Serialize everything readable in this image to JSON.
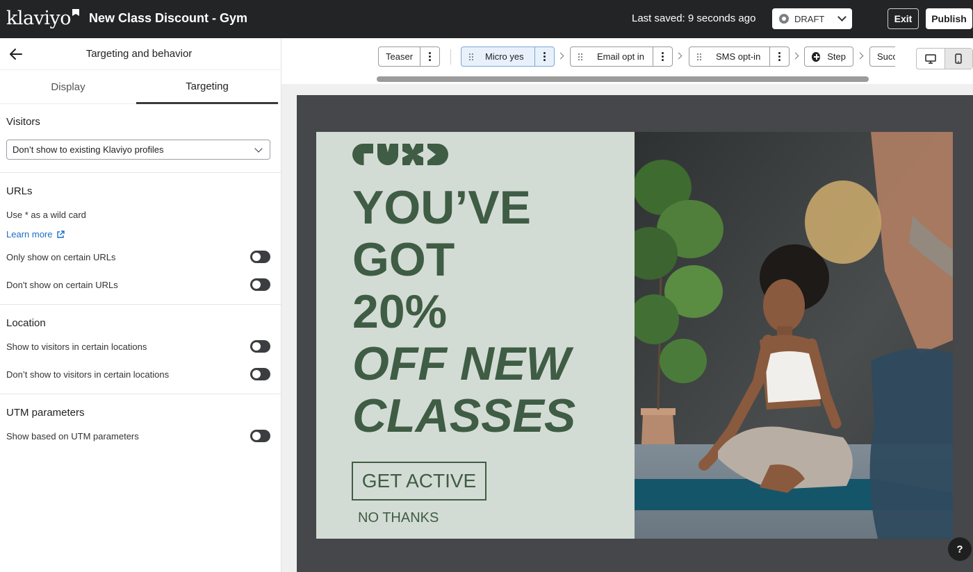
{
  "header": {
    "logo_text": "klaviyo",
    "title": "New Class Discount - Gym",
    "last_saved": "Last saved: 9 seconds ago",
    "status": "DRAFT",
    "exit_label": "Exit",
    "publish_label": "Publish"
  },
  "panel": {
    "title": "Targeting and behavior",
    "tabs": [
      {
        "label": "Display",
        "active": false
      },
      {
        "label": "Targeting",
        "active": true
      }
    ],
    "visitors": {
      "heading": "Visitors",
      "selected": "Don’t show to existing Klaviyo profiles"
    },
    "urls": {
      "heading": "URLs",
      "hint": "Use * as a wild card",
      "learn_more": "Learn more",
      "rows": [
        {
          "label": "Only show on certain URLs",
          "on": false
        },
        {
          "label": "Don't show on certain URLs",
          "on": false
        }
      ]
    },
    "location": {
      "heading": "Location",
      "rows": [
        {
          "label": "Show to visitors in certain locations",
          "on": false
        },
        {
          "label": "Don’t show to visitors in certain locations",
          "on": false
        }
      ]
    },
    "utm": {
      "heading": "UTM parameters",
      "rows": [
        {
          "label": "Show based on UTM parameters",
          "on": false
        }
      ]
    }
  },
  "steps": [
    {
      "label": "Teaser",
      "active": false
    },
    {
      "label": "Micro yes",
      "active": true
    },
    {
      "label": "Email opt in",
      "active": false
    },
    {
      "label": "SMS opt-in",
      "active": false
    },
    {
      "label": "Step",
      "active": false
    },
    {
      "label": "Succ",
      "active": false
    }
  ],
  "popup": {
    "headline_lines": [
      "YOU’VE",
      "GOT",
      "20%"
    ],
    "headline_italic_lines": [
      "OFF NEW",
      "CLASSES"
    ],
    "cta_label": "GET ACTIVE",
    "dismiss_label": "NO THANKS",
    "accent_color": "#3f5c44",
    "panel_color": "#d3dcd4"
  },
  "help_label": "?"
}
